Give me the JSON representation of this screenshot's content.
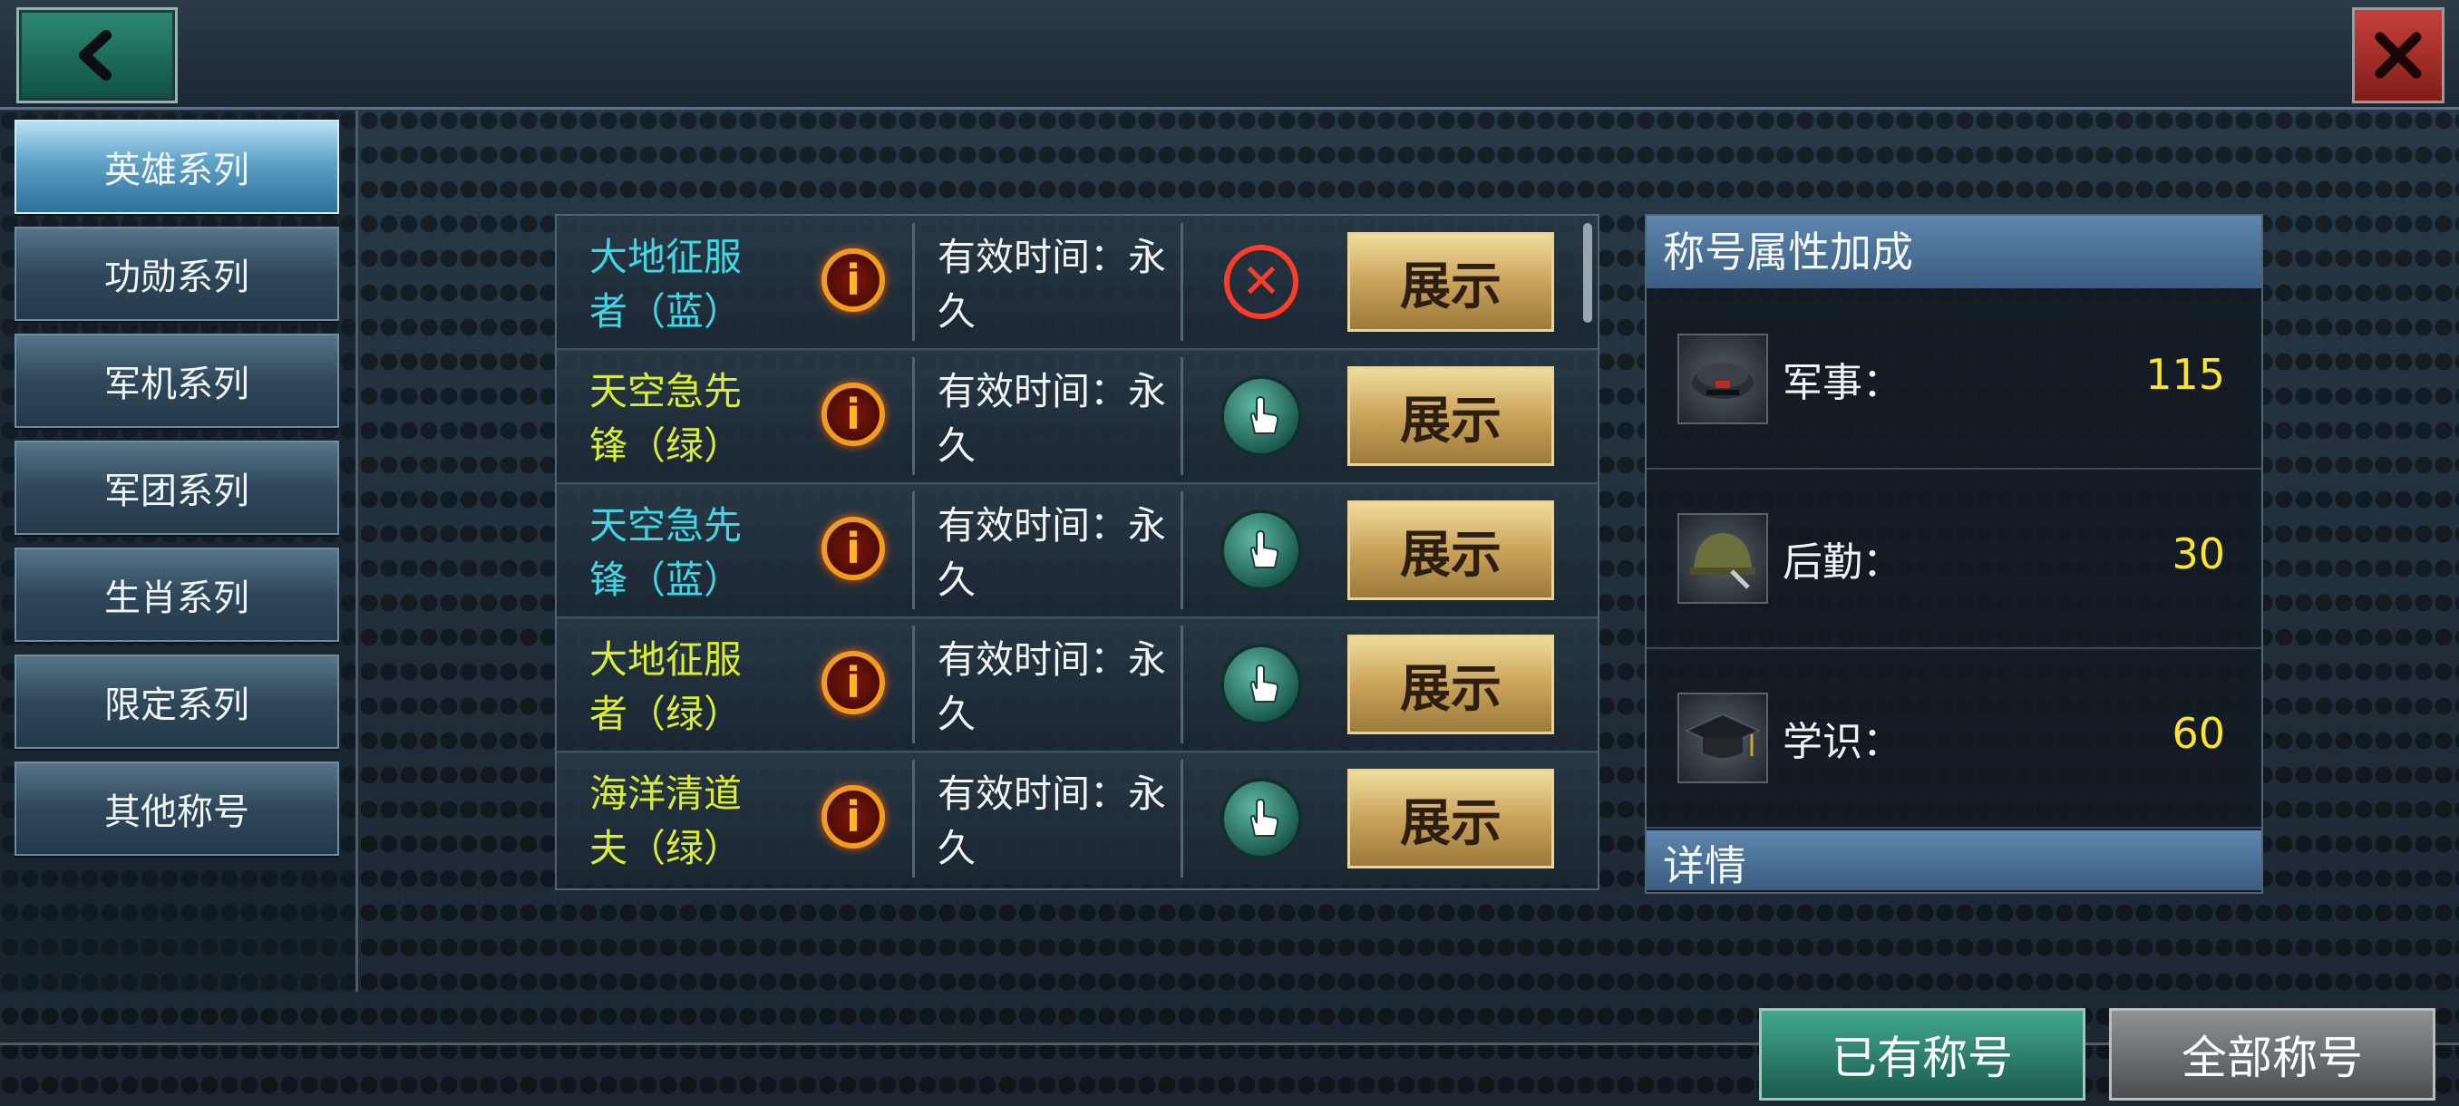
{
  "sidebar": {
    "items": [
      {
        "label": "英雄系列",
        "active": true
      },
      {
        "label": "功勋系列"
      },
      {
        "label": "军机系列"
      },
      {
        "label": "军团系列"
      },
      {
        "label": "生肖系列"
      },
      {
        "label": "限定系列"
      },
      {
        "label": "其他称号"
      }
    ]
  },
  "titles": [
    {
      "name": "大地征服者（蓝）",
      "name_color": "#3fd6e6",
      "validity": "有效时间：永久",
      "action_icon": "cancel-icon",
      "button": "展示"
    },
    {
      "name": "天空急先锋（绿）",
      "name_color": "#d9ee2c",
      "validity": "有效时间：永久",
      "action_icon": "hand-pointer-icon",
      "button": "展示"
    },
    {
      "name": "天空急先锋（蓝）",
      "name_color": "#3fd6e6",
      "validity": "有效时间：永久",
      "action_icon": "hand-pointer-icon",
      "button": "展示"
    },
    {
      "name": "大地征服者（绿）",
      "name_color": "#d9ee2c",
      "validity": "有效时间：永久",
      "action_icon": "hand-pointer-icon",
      "button": "展示"
    },
    {
      "name": "海洋清道夫（绿）",
      "name_color": "#d9ee2c",
      "validity": "有效时间：永久",
      "action_icon": "hand-pointer-icon",
      "button": "展示"
    }
  ],
  "attributes": {
    "header": "称号属性加成",
    "items": [
      {
        "label": "军事：",
        "value": "115",
        "icon": "officer-cap-icon"
      },
      {
        "label": "后勤：",
        "value": "30",
        "icon": "helmet-icon"
      },
      {
        "label": "学识：",
        "value": "60",
        "icon": "graduation-cap-icon"
      }
    ],
    "detail_header": "详情"
  },
  "bottom_tabs": {
    "owned": "已有称号",
    "all": "全部称号"
  },
  "colors": {
    "accent_teal": "#2d8a75",
    "value_yellow": "#ffe61e",
    "button_gold": "#caa35a"
  }
}
